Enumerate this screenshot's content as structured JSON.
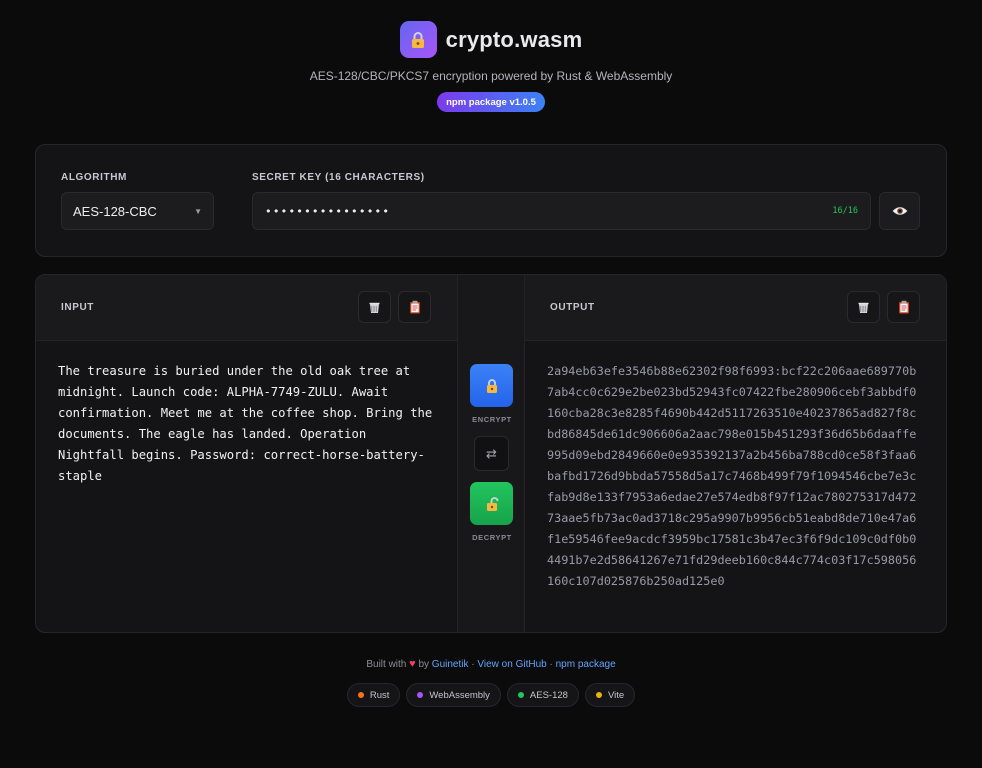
{
  "header": {
    "title": "crypto.wasm",
    "subtitle": "AES-128/CBC/PKCS7 encryption powered by Rust & WebAssembly",
    "badge": "npm package v1.0.5",
    "logo_icon": "lock-icon"
  },
  "settings": {
    "algorithm_label": "ALGORITHM",
    "algorithm_value": "AES-128-CBC",
    "key_label": "SECRET KEY (16 CHARACTERS)",
    "key_masked": "••••••••••••••••",
    "key_counter": "16/16",
    "reveal_icon": "eye-icon"
  },
  "input": {
    "title": "INPUT",
    "text": "The treasure is buried under the old oak tree at midnight. Launch code: ALPHA-7749-ZULU. Await confirmation. Meet me at the coffee shop. Bring the documents. The eagle has landed. Operation Nightfall begins. Password: correct-horse-battery-staple",
    "clear_icon": "trash-icon",
    "paste_icon": "clipboard-icon"
  },
  "actions": {
    "encrypt_label": "ENCRYPT",
    "decrypt_label": "DECRYPT",
    "swap_icon": "swap-icon",
    "encrypt_icon": "lock-icon",
    "decrypt_icon": "unlock-icon"
  },
  "output": {
    "title": "OUTPUT",
    "text": "2a94eb63efe3546b88e62302f98f6993:bcf22c206aae689770b7ab4cc0c629e2be023bd52943fc07422fbe280906cebf3abbdf0160cba28c3e8285f4690b442d5117263510e40237865ad827f8cbd86845de61dc906606a2aac798e015b451293f36d65b6daaffe995d09ebd2849660e0e935392137a2b456ba788cd0ce58f3faa6bafbd1726d9bbda57558d5a17c7468b499f79f1094546cbe7e3cfab9d8e133f7953a6edae27e574edb8f97f12ac780275317d47273aae5fb73ac0ad3718c295a9907b9956cb51eabd8de710e47a6f1e59546fee9acdcf3959bc17581c3b47ec3f6f9dc109c0df0b04491b7e2d58641267e71fd29deeb160c844c774c03f17c598056160c107d025876b250ad125e0",
    "clear_icon": "trash-icon",
    "copy_icon": "clipboard-icon"
  },
  "footer": {
    "built_with": "Built with",
    "by": "by",
    "author": "Guinetik",
    "sep1": "·",
    "github": "View on GitHub",
    "sep2": "·",
    "npm": "npm package",
    "tags": [
      {
        "label": "Rust",
        "color": "#f97316"
      },
      {
        "label": "WebAssembly",
        "color": "#a855f7"
      },
      {
        "label": "AES-128",
        "color": "#22c55e"
      },
      {
        "label": "Vite",
        "color": "#eab308"
      }
    ]
  }
}
